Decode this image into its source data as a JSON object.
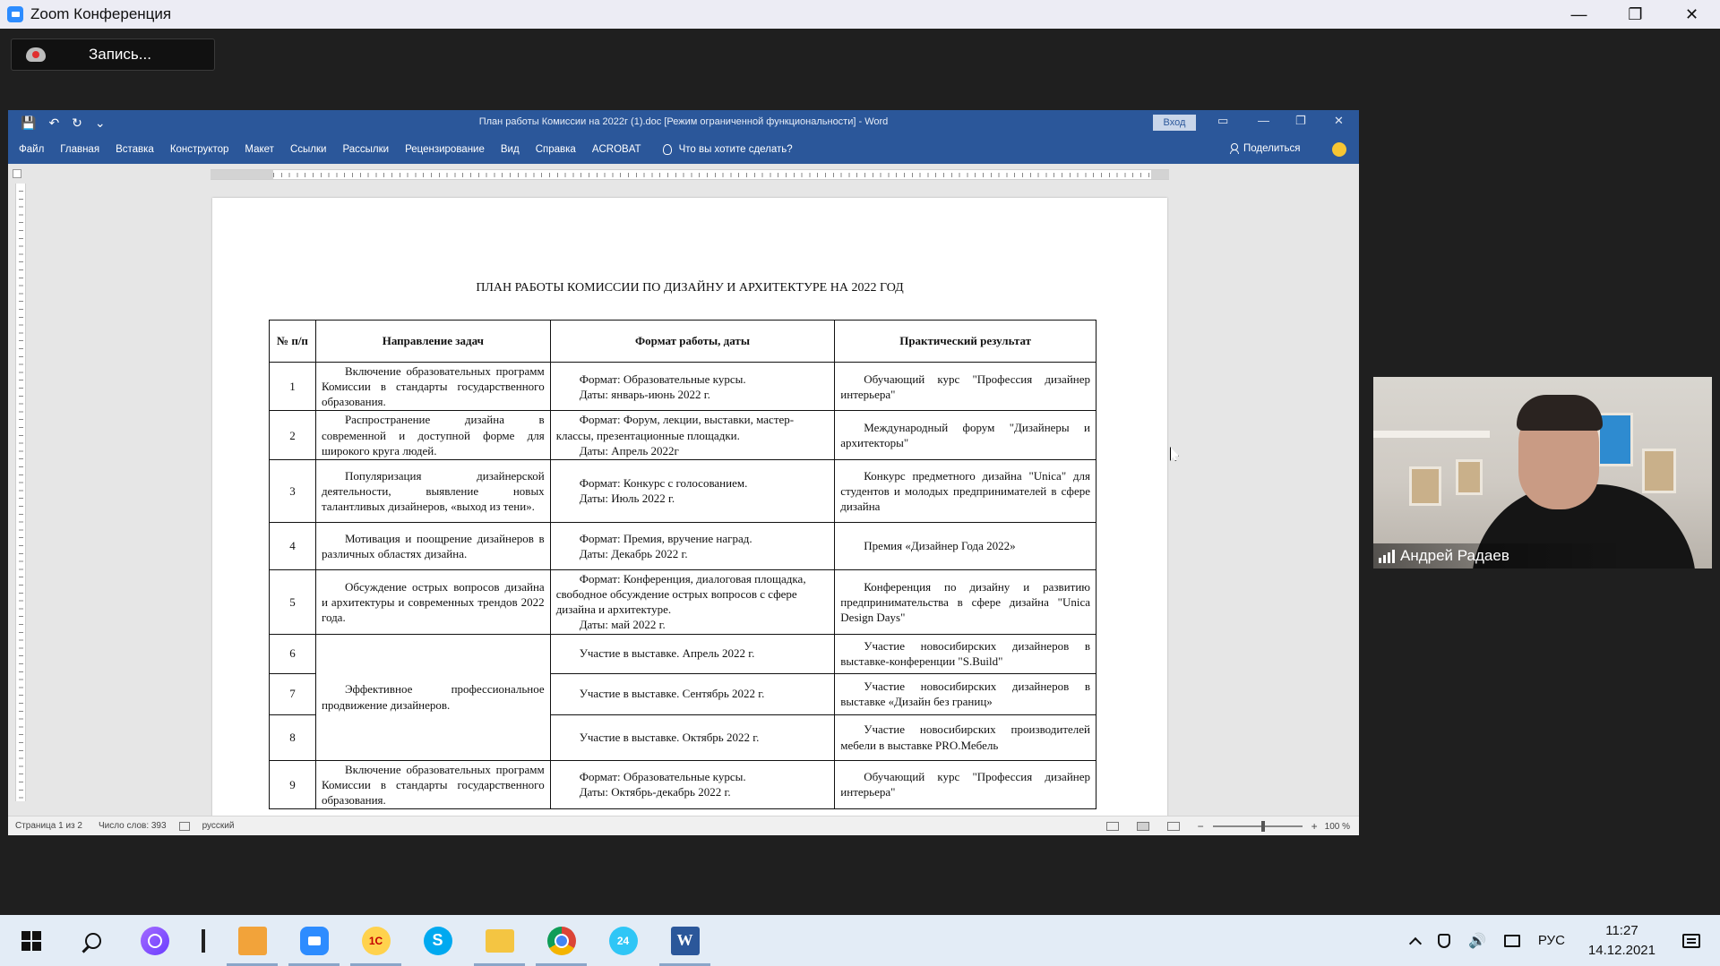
{
  "zoom": {
    "title": "Zoom Конференция",
    "window_controls": [
      "—",
      "❐",
      "✕"
    ],
    "record_label": "Запись..."
  },
  "word": {
    "doc_title": "План работы Комиссии на 2022г (1).doc [Режим ограниченной функциональности] - Word",
    "login_label": "Вход",
    "quick_access": [
      "💾",
      "↶",
      "↻",
      "⌄"
    ],
    "window_controls": [
      "▭",
      "—",
      "❐",
      "✕"
    ],
    "menu": [
      "Файл",
      "Главная",
      "Вставка",
      "Конструктор",
      "Макет",
      "Ссылки",
      "Рассылки",
      "Рецензирование",
      "Вид",
      "Справка",
      "ACROBAT"
    ],
    "tell_me": "Что вы хотите сделать?",
    "share": "Поделиться",
    "status": {
      "page": "Страница 1 из 2",
      "words": "Число слов: 393",
      "language": "русский",
      "zoom": "100 %",
      "zoom_minus": "−",
      "zoom_plus": "+"
    }
  },
  "document": {
    "heading": "ПЛАН РАБОТЫ КОМИССИИ ПО ДИЗАЙНУ И АРХИТЕКТУРЕ НА 2022 ГОД",
    "headers": [
      "№ п/п",
      "Направление задач",
      "Формат работы, даты",
      "Практический результат"
    ],
    "rows": [
      {
        "num": "1",
        "direction": "Включение образовательных программ Комиссии в стандарты государственного образования.",
        "format": [
          "Формат: Образовательные курсы.",
          "Даты: январь-июнь 2022 г."
        ],
        "result": "Обучающий курс \"Профессия дизайнер интерьера\""
      },
      {
        "num": "2",
        "direction": "Распространение дизайна в современной и доступной форме для широкого круга людей.",
        "format": [
          "Формат: Форум, лекции, выставки, мастер-классы, презентационные площадки.",
          "Даты: Апрель 2022г"
        ],
        "result": "Международный форум \"Дизайнеры и архитекторы\""
      },
      {
        "num": "3",
        "direction": "Популяризация дизайнерской деятельности, выявление новых талантливых дизайнеров, «выход из тени».",
        "format": [
          "Формат: Конкурс с голосованием.",
          "Даты: Июль 2022 г."
        ],
        "result": "Конкурс предметного дизайна \"Unica\" для студентов и молодых предпринимателей в сфере дизайна"
      },
      {
        "num": "4",
        "direction": "Мотивация и поощрение дизайнеров в различных областях дизайна.",
        "format": [
          "Формат: Премия, вручение наград.",
          "Даты: Декабрь 2022 г."
        ],
        "result": "Премия «Дизайнер Года 2022»"
      },
      {
        "num": "5",
        "direction": "Обсуждение острых вопросов дизайна и архитектуры и современных трендов 2022 года.",
        "format": [
          "Формат: Конференция, диалоговая площадка, свободное обсуждение острых вопросов с сфере дизайна и архитектуре.",
          "Даты: май 2022 г."
        ],
        "result": "Конференция по дизайну и развитию предпринимательства в сфере дизайна \"Unica Design Days\""
      },
      {
        "num": "6",
        "direction": "Эффективное профессиональное продвижение дизайнеров.",
        "format": [
          "Участие в выставке. Апрель 2022 г."
        ],
        "result": "Участие новосибирских дизайнеров в выставке-конференции \"S.Build\""
      },
      {
        "num": "7",
        "direction": "",
        "format": [
          "Участие в выставке. Сентябрь 2022 г."
        ],
        "result": "Участие новосибирских дизайнеров в выставке «Дизайн без границ»"
      },
      {
        "num": "8",
        "direction": "",
        "format": [
          "Участие в выставке. Октябрь 2022 г."
        ],
        "result": "Участие новосибирских производителей мебели в выставке PRO.Мебель"
      },
      {
        "num": "9",
        "direction": "Включение образовательных программ Комиссии в стандарты государственного образования.",
        "format": [
          "Формат: Образовательные курсы.",
          "Даты: Октябрь-декабрь 2022 г."
        ],
        "result": "Обучающий курс \"Профессия дизайнер интерьера\""
      }
    ]
  },
  "video": {
    "participant_name": "Андрей Радаев"
  },
  "taskbar": {
    "apps": [
      "start-icon",
      "search-icon",
      "alice-icon",
      "divider-icon",
      "outlook-icon",
      "zoom-icon",
      "1c-icon",
      "skype-icon",
      "explorer-icon",
      "chrome-icon",
      "bitrix24-icon",
      "word-icon"
    ],
    "onec_label": "1С",
    "skype_label": "S",
    "b24_label": "24",
    "word_label": "W",
    "language": "РУС",
    "time": "11:27",
    "date": "14.12.2021"
  }
}
